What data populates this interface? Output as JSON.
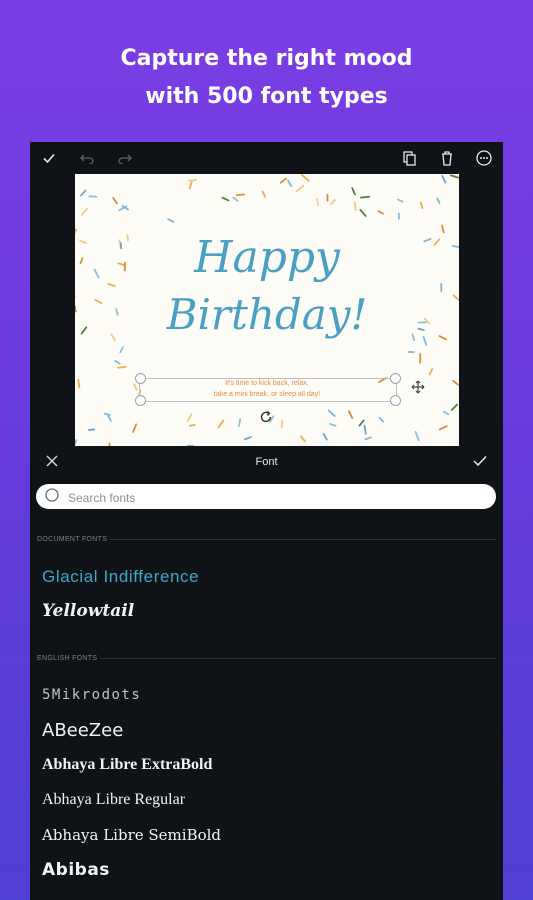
{
  "headline": {
    "line1": "Capture the right mood",
    "line2": "with 500 font types"
  },
  "toolbar": {
    "icons": [
      "check-icon",
      "undo-icon",
      "redo-icon",
      "copy-icon",
      "trash-icon",
      "more-icon"
    ]
  },
  "canvas": {
    "title_line1": "Happy",
    "title_line2": "Birthday!",
    "caption_line1": "It's time to kick back, relax,",
    "caption_line2": "take a mini break, or sleep all day!",
    "title_color": "#4aa0c4",
    "caption_color": "#e6893a"
  },
  "font_panel": {
    "title": "Font",
    "search_placeholder": "Search fonts",
    "sections": [
      {
        "label": "DOCUMENT FONTS",
        "fonts": [
          "Glacial Indifference",
          "Yellowtail"
        ]
      },
      {
        "label": "ENGLISH FONTS",
        "fonts": [
          "5Mikrodots",
          "ABeeZee",
          "Abhaya Libre ExtraBold",
          "Abhaya Libre Regular",
          "Abhaya Libre SemiBold",
          "Abibas"
        ]
      }
    ],
    "selected_font_color": "#3aa9c8"
  }
}
